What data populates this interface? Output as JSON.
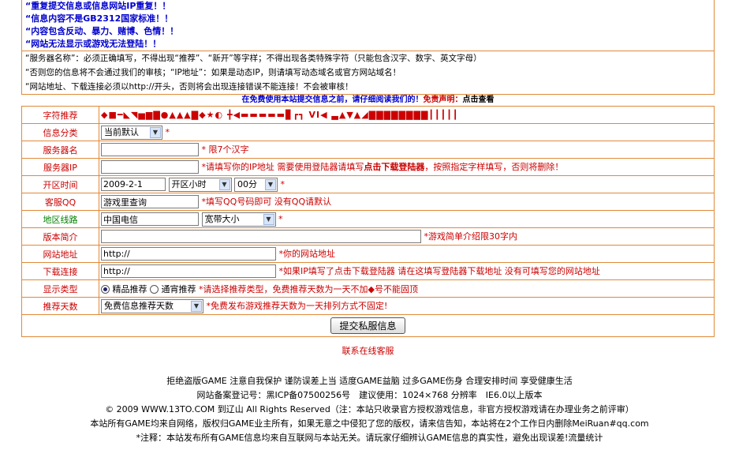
{
  "warnings": [
    "“重复提交信息或信息网站IP重复！！",
    "“信息内容不是GB2312国家标准！！",
    "“内容包含反动、暴力、赌博、色情！！",
    "“网站无法显示或游戏无法登陆！！"
  ],
  "rules": [
    "“服务器名称”：必须正确填写，不得出现“推荐”、“新开”等字样；不得出现各类特殊字符（只能包含汉字、数字、英文字母）",
    "“否则您的信息将不会通过我们的审核；“IP地址”：如果是动态IP，则请填写动态域名或官方网站域名！",
    "“网站地址、下载连接必须以http://开头，否则将会出现连接错误不能连接！不会被审核！"
  ],
  "promo": {
    "blue": "在免费使用本站提交信息之前，请仔细阅读我们的！",
    "red": "免责声明：",
    "black": "点击查看"
  },
  "form": {
    "symbol": {
      "label": "字符推荐",
      "chars": "◆■━◣◥▅▆▇●▲▲▲▇◆★◐ ╋◀▬▬▬▬▬▊┏┓ VI◀ ▃▲▼▲◢▇▇▇▇▇▇▇▇┃┃┃┃┃"
    },
    "category": {
      "label": "信息分类",
      "selected": "当前默认",
      "star": "*"
    },
    "server_name": {
      "label": "服务器名",
      "value": "",
      "hint": "* 限7个汉字"
    },
    "server_ip": {
      "label": "服务器IP",
      "value": "",
      "hint_a": "*请填写你的IP地址 需要使用登陆器请填写",
      "hint_b": "点击下载登陆器",
      "hint_c": "，按照指定字样填写，否则将删除！"
    },
    "open_time": {
      "label": "开区时间",
      "date": "2009-2-1",
      "hour": "开区小时",
      "minute": "00分",
      "star": "*"
    },
    "qq": {
      "label": "客服QQ",
      "value": "游戏里查询",
      "hint": "*填写QQ号码即可 没有QQ请默认"
    },
    "line": {
      "label": "地区线路",
      "value": "中国电信",
      "bandwidth": "宽带大小",
      "star": "*"
    },
    "intro": {
      "label": "版本简介",
      "value": "",
      "hint": "*游戏简单介绍限30字内"
    },
    "site": {
      "label": "网站地址",
      "value": "http://",
      "hint": "*你的网站地址"
    },
    "download": {
      "label": "下载连接",
      "value": "http://",
      "hint": "*如果IP填写了点击下载登陆器 请在这填写登陆器下载地址 没有可填写您的网站地址"
    },
    "display": {
      "label": "显示类型",
      "opt1": "精品推荐",
      "opt2": "通宵推荐",
      "hint": "*请选择推荐类型，免费推荐天数为一天不加◆号不能固顶"
    },
    "days": {
      "label": "推荐天数",
      "selected": "免费信息推荐天数",
      "hint": "*免费发布游戏推荐天数为一天排列方式不固定!"
    },
    "submit": "提交私服信息"
  },
  "service": "联系在线客服",
  "footer": [
    "拒绝盗版GAME 注意自我保护 谨防误差上当 适度GAME益脑 过多GAME伤身 合理安排时间 享受健康生活",
    "网站备案登记号：黑ICP备07500256号　建议使用：1024×768 分辨率　IE6.0以上版本",
    "© 2009 WWW.13TO.COM 到辽山 All Rights Reserved（注：本站只收录官方授权游戏信息，非官方授权游戏请在办理业务之前评审）",
    "本站所有GAME均来自网络，版权归GAME业主所有，如果无意之中侵犯了您的版权，请来信告知，本站将在2个工作日内删除MeiRuan#qq.com",
    "*注释：本站发布所有GAME信息均来自互联网与本站无关。请玩家仔细辨认GAME信息的真实性，避免出现误差!流量统计"
  ]
}
